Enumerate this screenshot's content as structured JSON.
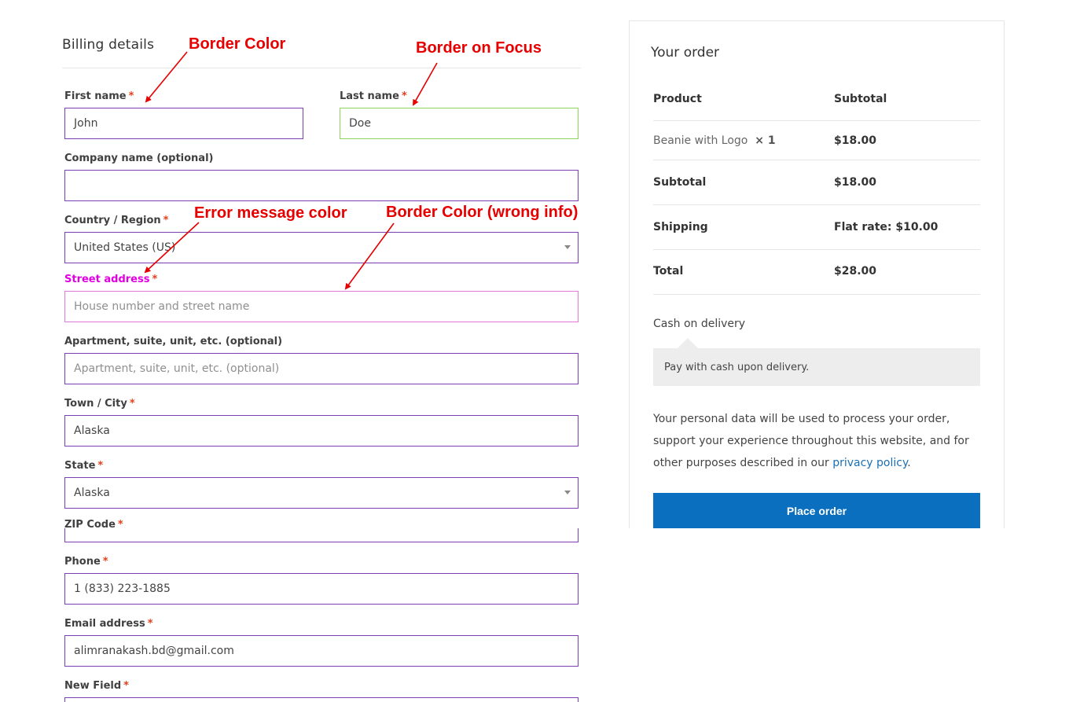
{
  "billing": {
    "title": "Billing details",
    "first_name": {
      "label": "First name",
      "value": "John"
    },
    "last_name": {
      "label": "Last name",
      "value": "Doe"
    },
    "company": {
      "label": "Company name (optional)",
      "value": ""
    },
    "country": {
      "label": "Country / Region",
      "value": "United States (US)"
    },
    "street": {
      "label": "Street address",
      "placeholder": "House number and street name"
    },
    "apartment": {
      "label": "Apartment, suite, unit, etc. (optional)",
      "placeholder": "Apartment, suite, unit, etc. (optional)"
    },
    "city": {
      "label": "Town / City",
      "value": "Alaska"
    },
    "state": {
      "label": "State",
      "value": "Alaska"
    },
    "zip": {
      "label": "ZIP Code",
      "value": ""
    },
    "phone": {
      "label": "Phone",
      "value": "1 (833) 223-1885"
    },
    "email": {
      "label": "Email address",
      "value": "alimranakash.bd@gmail.com"
    },
    "new_field": {
      "label": "New Field"
    },
    "required_mark": "*"
  },
  "annotations": {
    "border_color": "Border Color",
    "border_on_focus": "Border on Focus",
    "error_message_color": "Error message color",
    "border_color_wrong": "Border Color (wrong info)"
  },
  "order": {
    "title": "Your order",
    "col_product": "Product",
    "col_subtotal": "Subtotal",
    "item_name": "Beanie with Logo",
    "item_qty": "× 1",
    "item_price": "$18.00",
    "subtotal_label": "Subtotal",
    "subtotal_value": "$18.00",
    "shipping_label": "Shipping",
    "shipping_value": "Flat rate: $10.00",
    "total_label": "Total",
    "total_value": "$28.00",
    "payment_method": "Cash on delivery",
    "payment_desc": "Pay with cash upon delivery.",
    "privacy_text": "Your personal data will be used to process your order, support your experience throughout this website, and for other purposes described in our",
    "privacy_link": "privacy policy",
    "privacy_end": ".",
    "place_order": "Place order"
  },
  "colors": {
    "border": "#7a3fb0",
    "focus_border": "#8fd35c",
    "error_text": "#e200e2",
    "error_border": "#e07ad6",
    "required": "#e2401c",
    "annotation": "#e60000",
    "button": "#0b6fbf"
  }
}
